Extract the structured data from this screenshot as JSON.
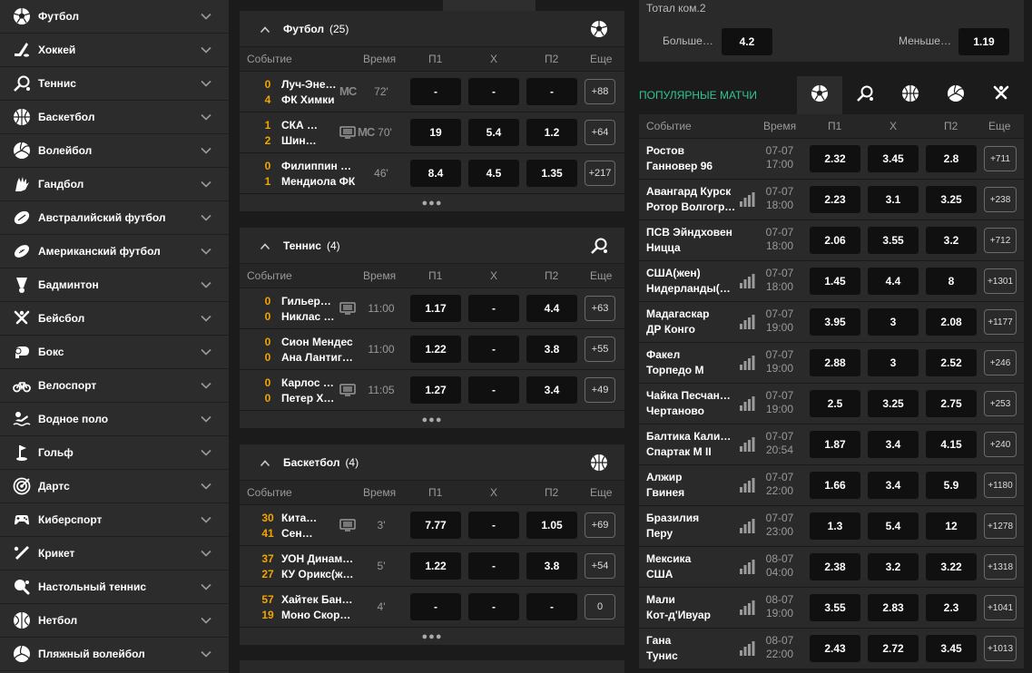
{
  "sidebar": {
    "items": [
      {
        "label": "Футбол",
        "icon": "soccer-ball-icon"
      },
      {
        "label": "Хоккей",
        "icon": "hockey-stick-icon"
      },
      {
        "label": "Теннис",
        "icon": "tennis-racket-icon"
      },
      {
        "label": "Баскетбол",
        "icon": "basketball-icon"
      },
      {
        "label": "Волейбол",
        "icon": "volleyball-icon"
      },
      {
        "label": "Гандбол",
        "icon": "handball-icon"
      },
      {
        "label": "Австралийский футбол",
        "icon": "aussie-football-icon"
      },
      {
        "label": "Американский футбол",
        "icon": "american-football-icon"
      },
      {
        "label": "Бадминтон",
        "icon": "shuttlecock-icon"
      },
      {
        "label": "Бейсбол",
        "icon": "baseball-bats-icon"
      },
      {
        "label": "Бокс",
        "icon": "boxing-glove-icon"
      },
      {
        "label": "Велоспорт",
        "icon": "bicycle-icon"
      },
      {
        "label": "Водное поло",
        "icon": "water-polo-icon"
      },
      {
        "label": "Гольф",
        "icon": "golf-icon"
      },
      {
        "label": "Дартс",
        "icon": "darts-target-icon"
      },
      {
        "label": "Киберспорт",
        "icon": "gamepad-icon"
      },
      {
        "label": "Крикет",
        "icon": "cricket-bat-icon"
      },
      {
        "label": "Настольный теннис",
        "icon": "table-tennis-icon"
      },
      {
        "label": "Нетбол",
        "icon": "netball-icon"
      },
      {
        "label": "Пляжный волейбол",
        "icon": "beach-volleyball-icon"
      }
    ]
  },
  "columns": {
    "event": "Событие",
    "time": "Время",
    "p1": "П1",
    "x": "Х",
    "p2": "П2",
    "more": "Еще"
  },
  "sections": [
    {
      "title": "Футбол",
      "count": "(25)",
      "icon": "soccer-ball-icon",
      "rows": [
        {
          "s1": "0",
          "s2": "4",
          "t1": "Луч-Эне…",
          "t2": "ФК Химки",
          "badge": "MC",
          "tv": false,
          "time": "72'",
          "p1": "-",
          "x": "-",
          "p2": "-",
          "more": "+88"
        },
        {
          "s1": "1",
          "s2": "2",
          "t1": "СКА …",
          "t2": "Шин…",
          "badge": "MC",
          "tv": true,
          "time": "70'",
          "p1": "19",
          "x": "5.4",
          "p2": "1.2",
          "more": "+64"
        },
        {
          "s1": "0",
          "s2": "1",
          "t1": "Филиппин …",
          "t2": "Мендиола ФК",
          "badge": "",
          "tv": false,
          "time": "46'",
          "p1": "8.4",
          "x": "4.5",
          "p2": "1.35",
          "more": "+217"
        }
      ]
    },
    {
      "title": "Теннис",
      "count": "(4)",
      "icon": "tennis-racket-icon",
      "rows": [
        {
          "s1": "0",
          "s2": "0",
          "t1": "Гильер…",
          "t2": "Никлас …",
          "badge": "",
          "tv": true,
          "time": "11:00",
          "p1": "1.17",
          "x": "-",
          "p2": "4.4",
          "more": "+63"
        },
        {
          "s1": "0",
          "s2": "0",
          "t1": "Сион Мендес",
          "t2": "Ана Лантиг…",
          "badge": "",
          "tv": false,
          "time": "11:00",
          "p1": "1.22",
          "x": "-",
          "p2": "3.8",
          "more": "+55"
        },
        {
          "s1": "0",
          "s2": "0",
          "t1": "Карлос …",
          "t2": "Петер Х…",
          "badge": "",
          "tv": true,
          "time": "11:05",
          "p1": "1.27",
          "x": "-",
          "p2": "3.4",
          "more": "+49"
        }
      ]
    },
    {
      "title": "Баскетбол",
      "count": "(4)",
      "icon": "basketball-icon",
      "rows": [
        {
          "s1": "30",
          "s2": "41",
          "t1": "Кита…",
          "t2": "Сен…",
          "badge": "",
          "tv": true,
          "time": "3'",
          "p1": "7.77",
          "x": "-",
          "p2": "1.05",
          "more": "+69"
        },
        {
          "s1": "37",
          "s2": "27",
          "t1": "УОН Динам…",
          "t2": "КУ Орикс(ж…",
          "badge": "",
          "tv": false,
          "time": "5'",
          "p1": "1.22",
          "x": "-",
          "p2": "3.8",
          "more": "+54"
        },
        {
          "s1": "57",
          "s2": "19",
          "t1": "Хайтек Бан…",
          "t2": "Моно Скор…",
          "badge": "",
          "tv": false,
          "time": "4'",
          "p1": "-",
          "x": "-",
          "p2": "-",
          "more": "0"
        }
      ]
    }
  ],
  "total": {
    "title": "Тотал ком.2",
    "over_label": "Больше…",
    "over_odd": "4.2",
    "under_label": "Меньше…",
    "under_odd": "1.19"
  },
  "popular": {
    "title": "ПОПУЛЯРНЫЕ МАТЧИ",
    "tabs": [
      "soccer-ball-icon",
      "tennis-racket-icon",
      "basketball-icon",
      "volleyball-icon",
      "baseball-bats-icon"
    ],
    "rows": [
      {
        "t1": "Ростов",
        "t2": "Ганновер 96",
        "bars": false,
        "d": "07-07",
        "tm": "17:00",
        "p1": "2.32",
        "x": "3.45",
        "p2": "2.8",
        "more": "+711"
      },
      {
        "t1": "Авангард Курск",
        "t2": "Ротор Волгоград",
        "bars": true,
        "d": "07-07",
        "tm": "18:00",
        "p1": "2.23",
        "x": "3.1",
        "p2": "3.25",
        "more": "+238"
      },
      {
        "t1": "ПСВ Эйндховен",
        "t2": "Ницца",
        "bars": false,
        "d": "07-07",
        "tm": "18:00",
        "p1": "2.06",
        "x": "3.55",
        "p2": "3.2",
        "more": "+712"
      },
      {
        "t1": "США(жен)",
        "t2": "Нидерланды(…",
        "bars": true,
        "d": "07-07",
        "tm": "18:00",
        "p1": "1.45",
        "x": "4.4",
        "p2": "8",
        "more": "+1301"
      },
      {
        "t1": "Мадагаскар",
        "t2": "ДР Конго",
        "bars": true,
        "d": "07-07",
        "tm": "19:00",
        "p1": "3.95",
        "x": "3",
        "p2": "2.08",
        "more": "+1177"
      },
      {
        "t1": "Факел",
        "t2": "Торпедо М",
        "bars": true,
        "d": "07-07",
        "tm": "19:00",
        "p1": "2.88",
        "x": "3",
        "p2": "2.52",
        "more": "+246"
      },
      {
        "t1": "Чайка Песчан…",
        "t2": "Чертаново",
        "bars": true,
        "d": "07-07",
        "tm": "19:00",
        "p1": "2.5",
        "x": "3.25",
        "p2": "2.75",
        "more": "+253"
      },
      {
        "t1": "Балтика Кали…",
        "t2": "Спартак М II",
        "bars": true,
        "d": "07-07",
        "tm": "20:54",
        "p1": "1.87",
        "x": "3.4",
        "p2": "4.15",
        "more": "+240"
      },
      {
        "t1": "Алжир",
        "t2": "Гвинея",
        "bars": true,
        "d": "07-07",
        "tm": "22:00",
        "p1": "1.66",
        "x": "3.4",
        "p2": "5.9",
        "more": "+1180"
      },
      {
        "t1": "Бразилия",
        "t2": "Перу",
        "bars": true,
        "d": "07-07",
        "tm": "23:00",
        "p1": "1.3",
        "x": "5.4",
        "p2": "12",
        "more": "+1278"
      },
      {
        "t1": "Мексика",
        "t2": "США",
        "bars": true,
        "d": "08-07",
        "tm": "04:00",
        "p1": "2.38",
        "x": "3.2",
        "p2": "3.22",
        "more": "+1318"
      },
      {
        "t1": "Мали",
        "t2": "Кот-д'Ивуар",
        "bars": true,
        "d": "08-07",
        "tm": "19:00",
        "p1": "3.55",
        "x": "2.83",
        "p2": "2.3",
        "more": "+1041"
      },
      {
        "t1": "Гана",
        "t2": "Тунис",
        "bars": true,
        "d": "08-07",
        "tm": "22:00",
        "p1": "2.43",
        "x": "2.72",
        "p2": "3.45",
        "more": "+1013"
      }
    ]
  },
  "colors": {
    "accent_green": "#2fc494",
    "score_orange": "#f0a500",
    "odd_bg": "#101010",
    "panel": "#2a2a2a",
    "sidebar": "#2c2c2c"
  }
}
